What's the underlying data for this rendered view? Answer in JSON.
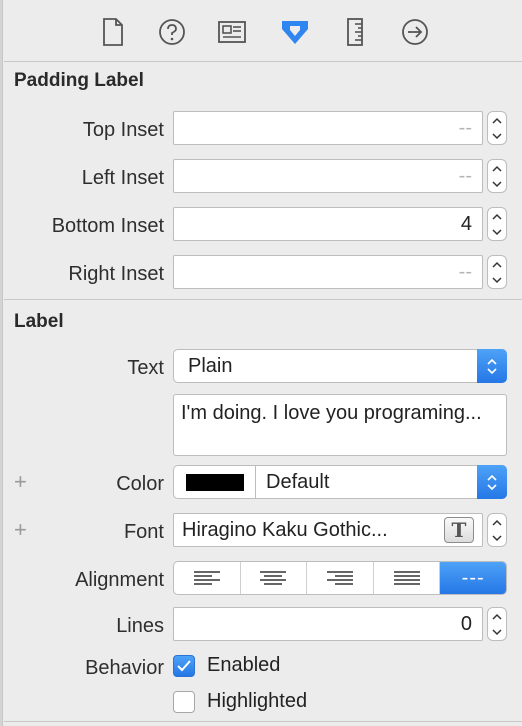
{
  "toolbar": {
    "tabs": [
      {
        "icon": "file-icon"
      },
      {
        "icon": "help-icon"
      },
      {
        "icon": "identity-icon"
      },
      {
        "icon": "attributes-icon",
        "active": true
      },
      {
        "icon": "ruler-icon"
      },
      {
        "icon": "connections-icon"
      }
    ]
  },
  "padding": {
    "title": "Padding Label",
    "top": {
      "label": "Top Inset",
      "value": "--"
    },
    "left": {
      "label": "Left Inset",
      "value": "--"
    },
    "bottom": {
      "label": "Bottom Inset",
      "value": "4"
    },
    "right": {
      "label": "Right Inset",
      "value": "--"
    }
  },
  "label": {
    "title": "Label",
    "text_label": "Text",
    "text_type": "Plain",
    "text_value": "I'm doing. I love you programing...",
    "color_label": "Color",
    "color_value": "Default",
    "swatch_color": "#000000",
    "font_label": "Font",
    "font_value": "Hiragino Kaku Gothic...",
    "font_button": "T",
    "alignment_label": "Alignment",
    "alignment_options": [
      "left",
      "center",
      "right",
      "justified",
      "natural"
    ],
    "alignment_natural": "---",
    "lines_label": "Lines",
    "lines_value": "0",
    "behavior_label": "Behavior",
    "enabled_label": "Enabled",
    "enabled_checked": true,
    "highlighted_label": "Highlighted",
    "highlighted_checked": false,
    "plus": "+"
  },
  "colors": {
    "accent": "#2f86f0",
    "background": "#ececec"
  }
}
